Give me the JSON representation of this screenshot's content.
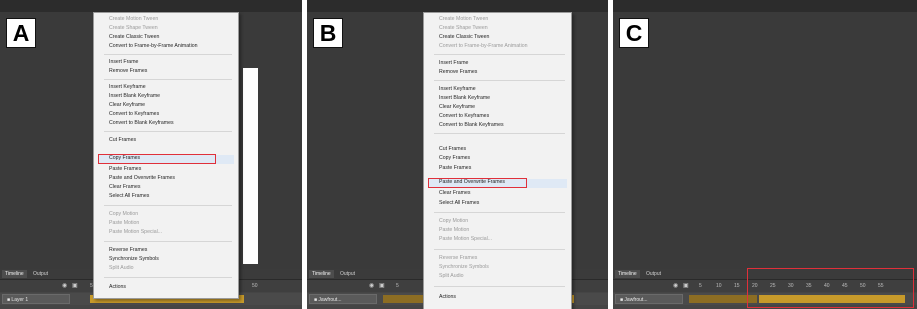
{
  "panels": [
    {
      "label": "A"
    },
    {
      "label": "B"
    },
    {
      "label": "C"
    }
  ],
  "timeline": {
    "tab_timeline": "Timeline",
    "tab_output": "Output",
    "layer_a": "Layer 1",
    "layer_b": "Jawfrout...",
    "layer_c": "Jawfrout...",
    "ruler_numbers": [
      "5",
      "10",
      "15",
      "20",
      "25",
      "30",
      "35",
      "40",
      "45",
      "50",
      "55"
    ]
  },
  "menu_a": {
    "items": [
      {
        "label": "Create Motion Tween",
        "disabled": true
      },
      {
        "label": "Create Shape Tween",
        "disabled": true
      },
      {
        "label": "Create Classic Tween",
        "disabled": false
      },
      {
        "label": "Convert to Frame-by-Frame Animation",
        "disabled": false
      },
      {
        "label": "Insert Frame",
        "disabled": false
      },
      {
        "label": "Remove Frames",
        "disabled": false
      },
      {
        "label": "Insert Keyframe",
        "disabled": false
      },
      {
        "label": "Insert Blank Keyframe",
        "disabled": false
      },
      {
        "label": "Clear Keyframe",
        "disabled": false
      },
      {
        "label": "Convert to Keyframes",
        "disabled": false
      },
      {
        "label": "Convert to Blank Keyframes",
        "disabled": false
      },
      {
        "label": "Cut Frames",
        "disabled": false
      },
      {
        "label": "Copy Frames",
        "disabled": false
      },
      {
        "label": "Paste Frames",
        "disabled": false
      },
      {
        "label": "Paste and Overwrite Frames",
        "disabled": false
      },
      {
        "label": "Clear Frames",
        "disabled": false
      },
      {
        "label": "Select All Frames",
        "disabled": false
      },
      {
        "label": "Copy Motion",
        "disabled": true
      },
      {
        "label": "Paste Motion",
        "disabled": true
      },
      {
        "label": "Paste Motion Special...",
        "disabled": true
      },
      {
        "label": "Reverse Frames",
        "disabled": false
      },
      {
        "label": "Synchronize Symbols",
        "disabled": false
      },
      {
        "label": "Split Audio",
        "disabled": true
      },
      {
        "label": "Actions",
        "disabled": false
      }
    ],
    "highlighted": "Copy Frames"
  },
  "menu_b": {
    "items": [
      {
        "label": "Create Motion Tween",
        "disabled": true
      },
      {
        "label": "Create Shape Tween",
        "disabled": true
      },
      {
        "label": "Create Classic Tween",
        "disabled": false
      },
      {
        "label": "Convert to Frame-by-Frame Animation",
        "disabled": true
      },
      {
        "label": "Insert Frame",
        "disabled": false
      },
      {
        "label": "Remove Frames",
        "disabled": false
      },
      {
        "label": "Insert Keyframe",
        "disabled": false
      },
      {
        "label": "Insert Blank Keyframe",
        "disabled": false
      },
      {
        "label": "Clear Keyframe",
        "disabled": false
      },
      {
        "label": "Convert to Keyframes",
        "disabled": false
      },
      {
        "label": "Convert to Blank Keyframes",
        "disabled": false
      },
      {
        "label": "Cut Frames",
        "disabled": false
      },
      {
        "label": "Copy Frames",
        "disabled": false
      },
      {
        "label": "Paste Frames",
        "disabled": false
      },
      {
        "label": "Paste and Overwrite Frames",
        "disabled": false
      },
      {
        "label": "Clear Frames",
        "disabled": false
      },
      {
        "label": "Select All Frames",
        "disabled": false
      },
      {
        "label": "Copy Motion",
        "disabled": true
      },
      {
        "label": "Paste Motion",
        "disabled": true
      },
      {
        "label": "Paste Motion Special...",
        "disabled": true
      },
      {
        "label": "Reverse Frames",
        "disabled": true
      },
      {
        "label": "Synchronize Symbols",
        "disabled": true
      },
      {
        "label": "Split Audio",
        "disabled": true
      },
      {
        "label": "Actions",
        "disabled": false
      }
    ],
    "highlighted": "Paste and Overwrite Frames"
  },
  "colors": {
    "stage": "#3a3a3a",
    "menu_bg": "#f2f2f2",
    "frames": "#c79a2a",
    "highlight_box": "#e0303a"
  }
}
